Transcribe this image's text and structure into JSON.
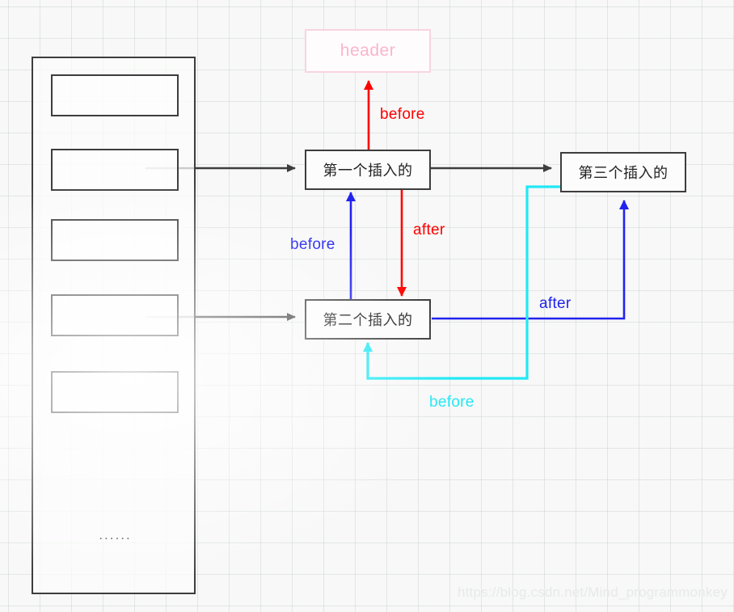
{
  "diagram": {
    "title": "Linked list insertion order diagram",
    "background": {
      "grid_color": "#c8d0cc",
      "page_color": "#f7f8f7"
    },
    "colors": {
      "node_border": "#3d3d3d",
      "header_border": "#f8d4e0",
      "header_text": "#f9b5cc",
      "red": "#ff0000",
      "blue": "#2222ee",
      "cyan": "#22e8f5",
      "black": "#3d3d3d",
      "watermark": "#e7eae9"
    },
    "array": {
      "label": "array-container",
      "ellipsis": "......",
      "cells": [
        {
          "name": "array-cell-1"
        },
        {
          "name": "array-cell-2"
        },
        {
          "name": "array-cell-3"
        },
        {
          "name": "array-cell-4"
        },
        {
          "name": "array-cell-5"
        }
      ]
    },
    "nodes": {
      "header": "header",
      "first": "第一个插入的",
      "second": "第二个插入的",
      "third": "第三个插入的"
    },
    "labels": {
      "before_red": "before",
      "after_red": "after",
      "before_blue": "before",
      "after_blue": "after",
      "before_cyan": "before"
    },
    "watermark": "https://blog.csdn.net/Mind_programmonkey"
  }
}
